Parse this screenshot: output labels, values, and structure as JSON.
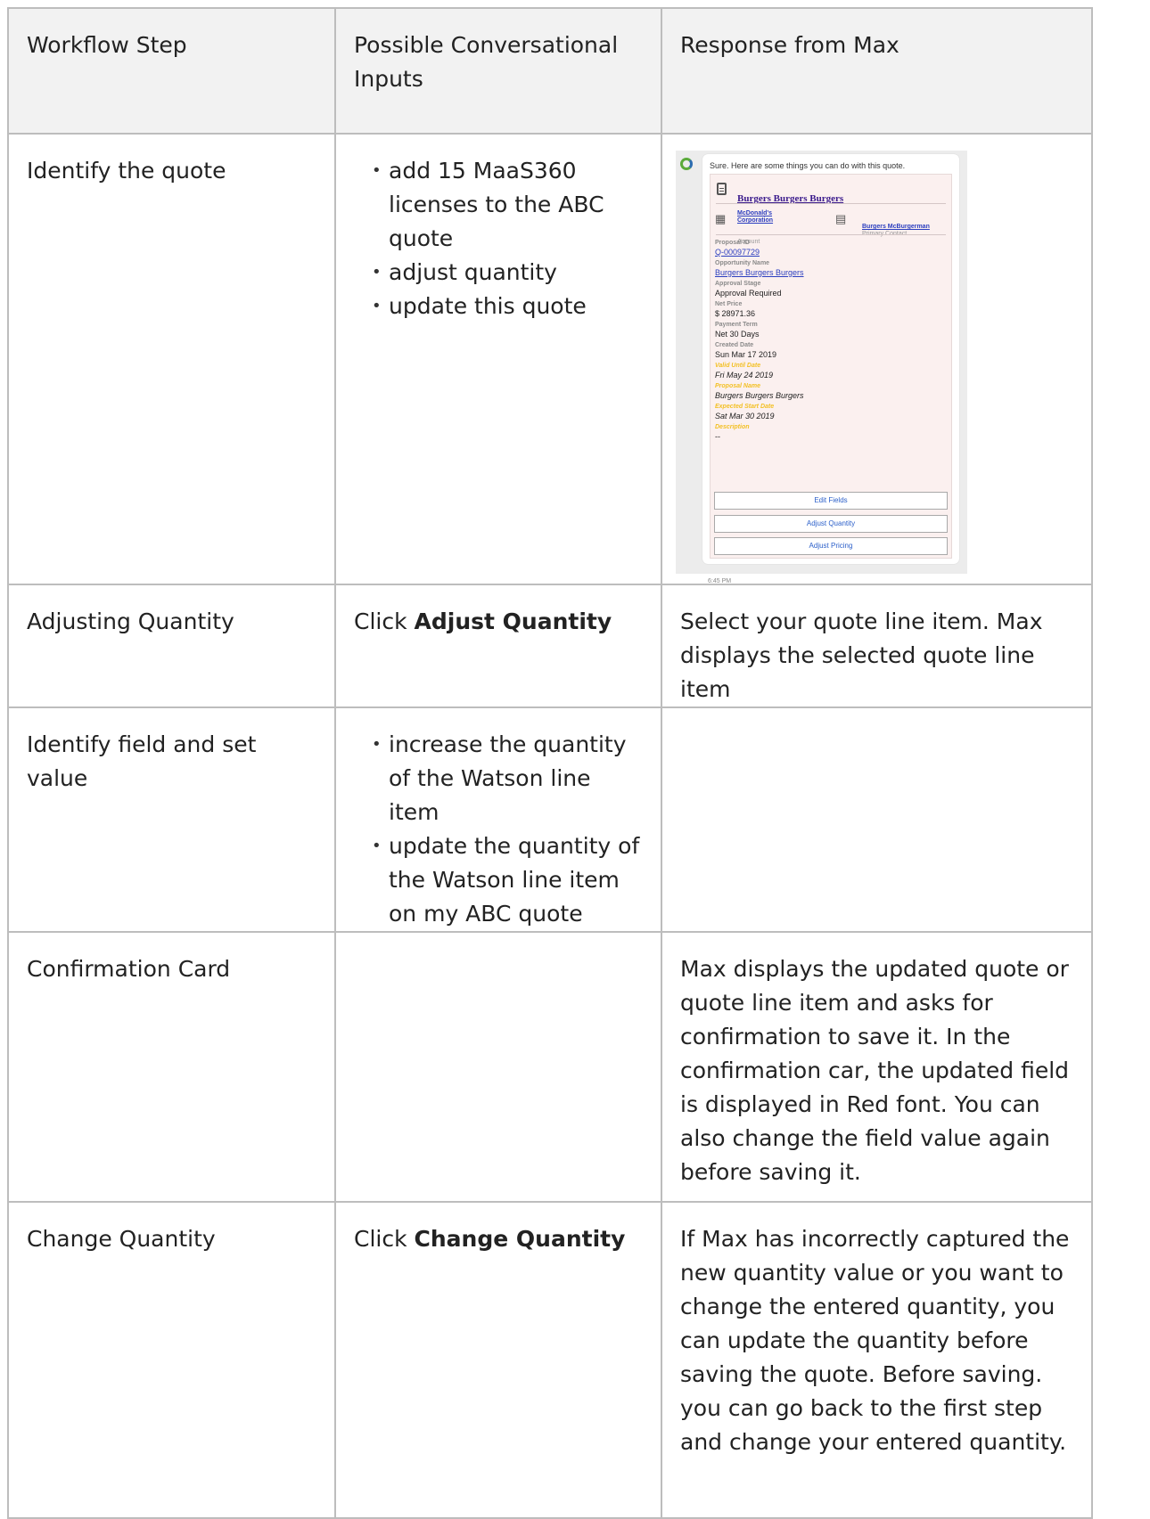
{
  "table": {
    "headers": [
      "Workflow Step",
      "Possible Conversational Inputs",
      "Response from Max"
    ],
    "rows": [
      {
        "step": "Identify the quote",
        "inputs": [
          "add 15 MaaS360 licenses to the ABC quote",
          "adjust quantity",
          "update this quote"
        ]
      },
      {
        "step": "Adjusting Quantity",
        "input_prefix": "Click ",
        "input_bold": "Adjust Quantity",
        "response": "Select your quote line item. Max displays the selected quote line item"
      },
      {
        "step": "Identify field and set value",
        "inputs": [
          "increase the quantity of the Watson line item",
          "update the quantity of the Watson line item on my ABC quote"
        ]
      },
      {
        "step": "Confirmation Card",
        "response": "Max displays the updated quote or quote line item and asks for confirmation to save it. In the confirmation car, the updated field is displayed in Red font. You can also change the field value again before saving it."
      },
      {
        "step": "Change Quantity",
        "input_prefix": "Click ",
        "input_bold": "Change Quantity",
        "response": "If Max has incorrectly captured the new quantity value or you want to change the entered quantity, you can update the quantity before saving the quote. Before saving. you can go back to the first step and change your entered quantity."
      }
    ]
  },
  "chat": {
    "intro": "Sure. Here are some things you can do with this quote.",
    "card_title": "Burgers Burgers Burgers",
    "account_name": "McDonald's Corporation",
    "account_label": "Account",
    "contact_name": "Burgers McBurgerman",
    "contact_label": "Primary Contact",
    "fields": [
      {
        "label": "Proposal ID",
        "value": "Q-00097729"
      },
      {
        "label": "Opportunity Name",
        "value": "Burgers Burgers Burgers"
      },
      {
        "label": "Approval Stage",
        "value": "Approval Required"
      },
      {
        "label": "Net Price",
        "value": "$ 28971.36"
      },
      {
        "label": "Payment Term",
        "value": "Net 30 Days"
      },
      {
        "label": "Created Date",
        "value": "Sun Mar 17 2019"
      },
      {
        "label": "Valid Until Date",
        "value": "Fri May 24 2019"
      },
      {
        "label": "Proposal Name",
        "value": "Burgers Burgers Burgers"
      },
      {
        "label": "Expected Start Date",
        "value": "Sat Mar 30 2019"
      },
      {
        "label": "Description",
        "value": "--"
      }
    ],
    "buttons": [
      "Edit Fields",
      "Adjust Quantity",
      "Adjust Pricing"
    ],
    "timestamp": "6:45 PM",
    "colors": {
      "avatar_green": "#5aaa3a",
      "card_background": "#fbf0ef",
      "link_blue": "#2b3ebf",
      "highlight_yellow": "#f3c024"
    },
    "icons": [
      "bot-avatar-icon",
      "document-icon",
      "building-icon",
      "contact-card-icon"
    ]
  }
}
